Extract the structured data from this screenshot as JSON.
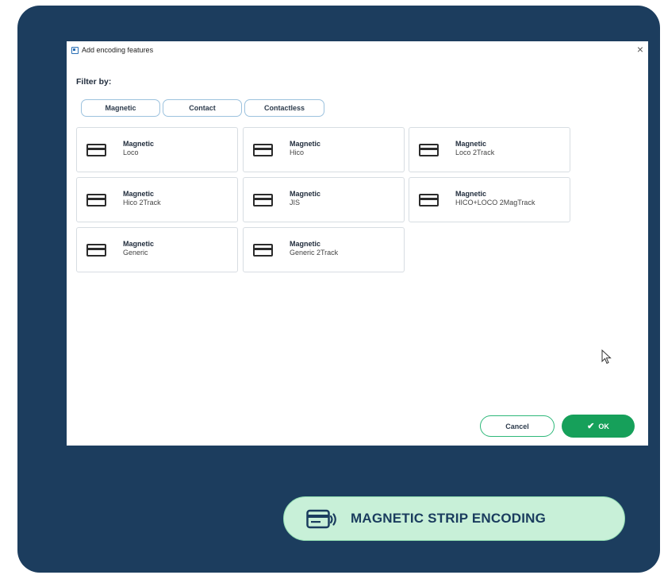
{
  "window": {
    "title": "Add encoding features",
    "close_glyph": "×"
  },
  "filter": {
    "label": "Filter by:",
    "buttons": [
      "Magnetic",
      "Contact",
      "Contactless"
    ]
  },
  "cards": [
    {
      "title": "Magnetic",
      "subtitle": "Loco",
      "icon": "magnetic-card-icon"
    },
    {
      "title": "Magnetic",
      "subtitle": "Hico",
      "icon": "magnetic-card-icon"
    },
    {
      "title": "Magnetic",
      "subtitle": "Loco 2Track",
      "icon": "magnetic-card-icon"
    },
    {
      "title": "Magnetic",
      "subtitle": "Hico 2Track",
      "icon": "magnetic-card-icon"
    },
    {
      "title": "Magnetic",
      "subtitle": "JIS",
      "icon": "magnetic-card-icon"
    },
    {
      "title": "Magnetic",
      "subtitle": "HICO+LOCO 2MagTrack",
      "icon": "magnetic-card-icon"
    },
    {
      "title": "Magnetic",
      "subtitle": "Generic",
      "icon": "magnetic-card-icon"
    },
    {
      "title": "Magnetic",
      "subtitle": "Generic 2Track",
      "icon": "magnetic-card-icon"
    }
  ],
  "actions": {
    "cancel_label": "Cancel",
    "ok_label": "OK",
    "ok_glyph": "✔"
  },
  "badge": {
    "label": "MAGNETIC STRIP ENCODING",
    "icon": "magnetic-card-reader-icon"
  },
  "colors": {
    "panel_bg": "#1c3d5e",
    "accent_green": "#16a05a",
    "badge_bg": "#c8f0d8",
    "filter_border": "#9cc2de"
  }
}
